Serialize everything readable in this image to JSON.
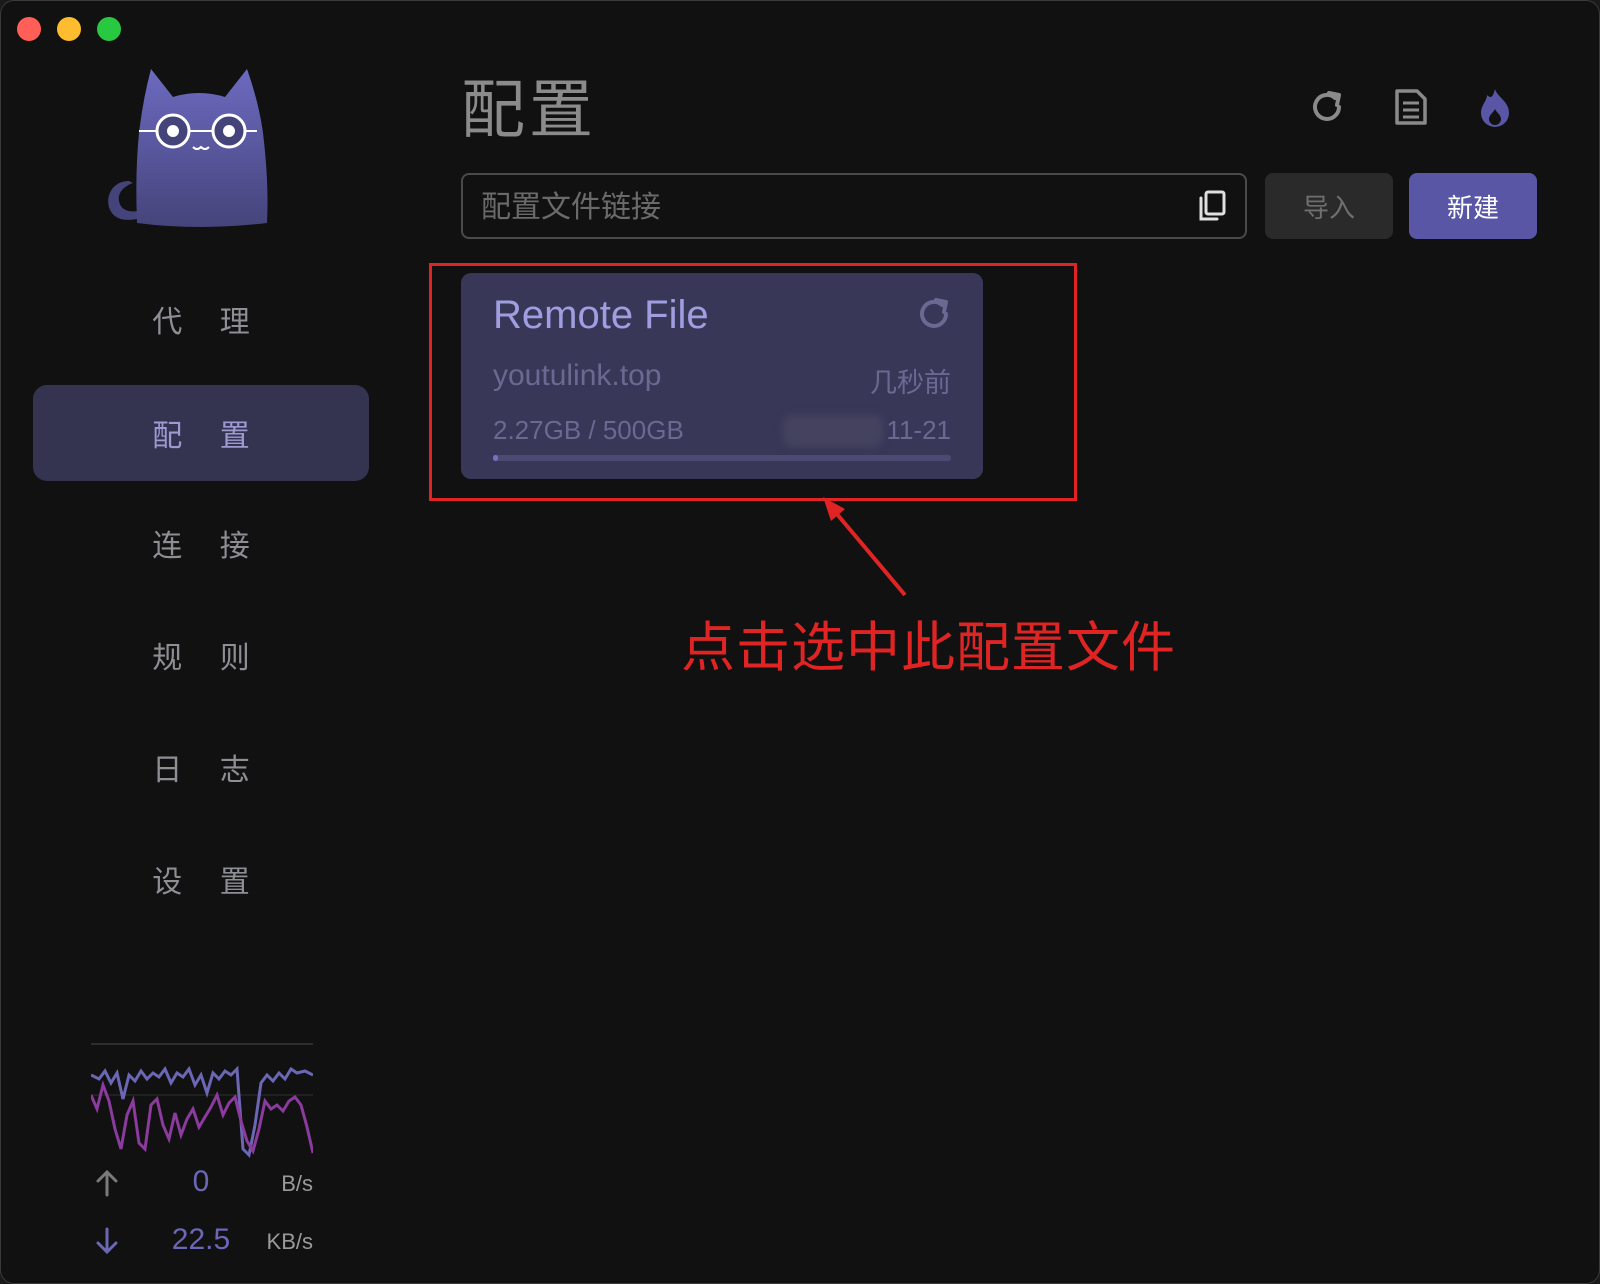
{
  "window": {
    "controls": [
      "close",
      "minimize",
      "zoom"
    ]
  },
  "sidebar": {
    "items": [
      {
        "label": "代 理",
        "icon": "none",
        "active": false
      },
      {
        "label": "配 置",
        "icon": "none",
        "active": true
      },
      {
        "label": "连 接",
        "icon": "none",
        "active": false
      },
      {
        "label": "规 则",
        "icon": "none",
        "active": false
      },
      {
        "label": "日 志",
        "icon": "none",
        "active": false
      },
      {
        "label": "设 置",
        "icon": "none",
        "active": false
      }
    ],
    "traffic": {
      "upload_value": "0",
      "upload_unit": "B/s",
      "download_value": "22.5",
      "download_unit": "KB/s",
      "upload_color": "#6b67b5",
      "download_color": "#8b3a9e"
    }
  },
  "header": {
    "title": "配置",
    "icons": [
      "refresh-icon",
      "document-icon",
      "flame-icon"
    ]
  },
  "url_bar": {
    "placeholder": "配置文件链接",
    "value": "",
    "import_label": "导入",
    "create_label": "新建"
  },
  "profile_card": {
    "name": "Remote File",
    "host": "youtulink.top",
    "updated": "几秒前",
    "usage": "2.27GB / 500GB",
    "expire": "11-21",
    "usage_fraction": 0.0045
  },
  "annotation": {
    "text": "点击选中此配置文件",
    "color": "#e02424"
  },
  "colors": {
    "accent": "#5957a5",
    "card_bg": "#383758",
    "background": "#111111"
  }
}
